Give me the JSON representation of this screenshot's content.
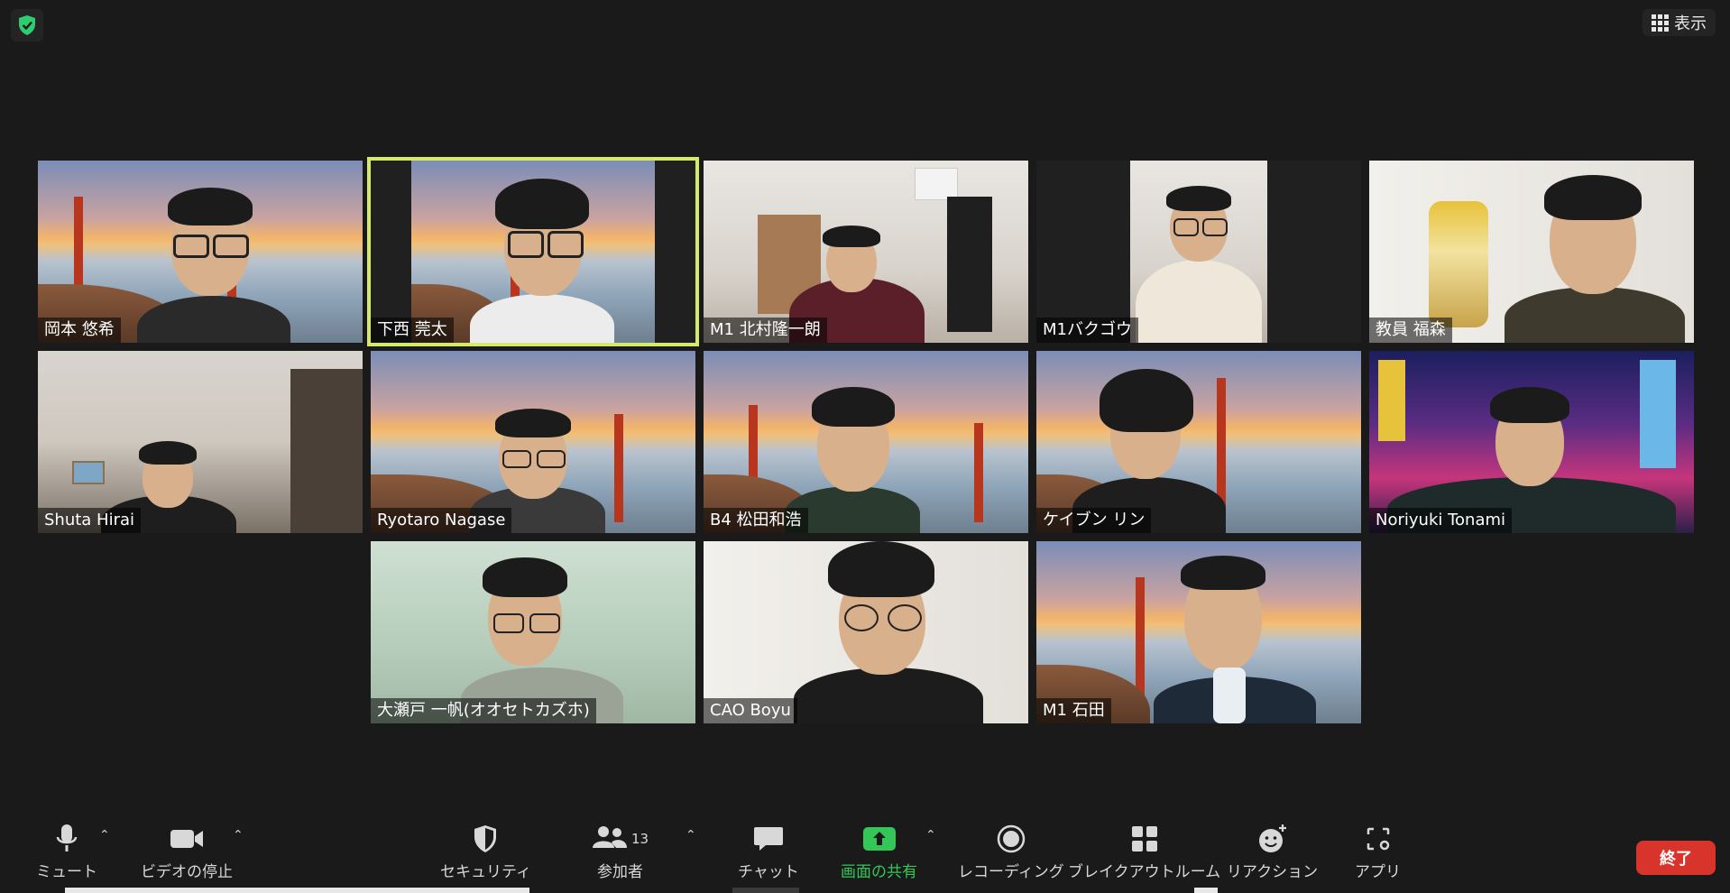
{
  "header": {
    "view_label": "表示"
  },
  "participants": [
    {
      "name": "岡本 悠希",
      "bg": "bridge"
    },
    {
      "name": "下西 莞太",
      "bg": "bridge",
      "active": true
    },
    {
      "name": "M1 北村隆一朗",
      "bg": "room"
    },
    {
      "name": "M1バクゴウ",
      "bg": "room"
    },
    {
      "name": "教員 福森",
      "bg": "white-room"
    },
    {
      "name": "Shuta Hirai",
      "bg": "room-dark"
    },
    {
      "name": "Ryotaro Nagase",
      "bg": "bridge"
    },
    {
      "name": "B4 松田和浩",
      "bg": "bridge"
    },
    {
      "name": "ケイブン リン",
      "bg": "bridge"
    },
    {
      "name": "Noriyuki Tonami",
      "bg": "neon"
    },
    {
      "name": "大瀬戸 一帆(オオセトカズホ)",
      "bg": "greenish"
    },
    {
      "name": "CAO Boyu",
      "bg": "white-room"
    },
    {
      "name": "M1 石田",
      "bg": "bridge"
    }
  ],
  "toolbar": {
    "mute": "ミュート",
    "video_stop": "ビデオの停止",
    "security": "セキュリティ",
    "participants": "参加者",
    "participants_count": "13",
    "chat": "チャット",
    "share": "画面の共有",
    "record": "レコーディング",
    "breakout": "ブレイクアウトルーム",
    "reaction": "リアクション",
    "apps": "アプリ",
    "end": "終了"
  },
  "colors": {
    "active_speaker": "#d6ea6a",
    "share_green": "#33c758",
    "end_red": "#d9342b",
    "security_green": "#2ecc71"
  }
}
